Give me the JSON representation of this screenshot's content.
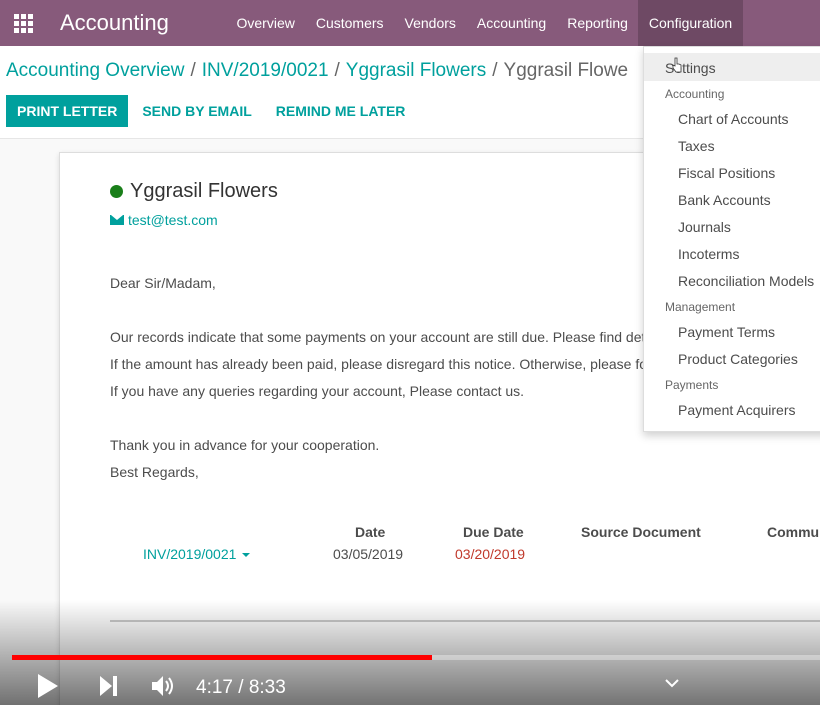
{
  "navbar": {
    "brand": "Accounting",
    "menu": [
      "Overview",
      "Customers",
      "Vendors",
      "Accounting",
      "Reporting",
      "Configuration"
    ]
  },
  "breadcrumb": [
    "Accounting Overview",
    "INV/2019/0021",
    "Yggrasil Flowers",
    "Yggrasil Flowe"
  ],
  "actions": {
    "print": "PRINT LETTER",
    "send": "SEND BY EMAIL",
    "remind": "REMIND ME LATER"
  },
  "partner": {
    "name": "Yggrasil Flowers",
    "email": "test@test.com",
    "status_color": "#1a7f1a"
  },
  "letter": {
    "greeting": "Dear Sir/Madam,",
    "line1": "Our records indicate that some payments on your account are still due. Please find deta",
    "line2": "If the amount has already been paid, please disregard this notice. Otherwise, please for",
    "line3": "If you have any queries regarding your account, Please contact us.",
    "thanks": "Thank you in advance for your cooperation.",
    "regards": "Best Regards,"
  },
  "table": {
    "headers": {
      "date": "Date",
      "due_date": "Due Date",
      "source": "Source Document",
      "comm": "Commun"
    },
    "row": {
      "invoice": "INV/2019/0021",
      "date": "03/05/2019",
      "due_date": "03/20/2019"
    }
  },
  "dropdown": {
    "settings": "Settings",
    "sections": [
      {
        "header": "Accounting",
        "items": [
          "Chart of Accounts",
          "Taxes",
          "Fiscal Positions",
          "Bank Accounts",
          "Journals",
          "Incoterms",
          "Reconciliation Models"
        ]
      },
      {
        "header": "Management",
        "items": [
          "Payment Terms",
          "Product Categories"
        ]
      },
      {
        "header": "Payments",
        "items": [
          "Payment Acquirers"
        ]
      }
    ]
  },
  "video": {
    "time": "4:17 / 8:33",
    "progress": 0.52
  },
  "colors": {
    "navbar": "#875a7b",
    "accent": "#00a09d",
    "overdue": "#c0392b"
  }
}
